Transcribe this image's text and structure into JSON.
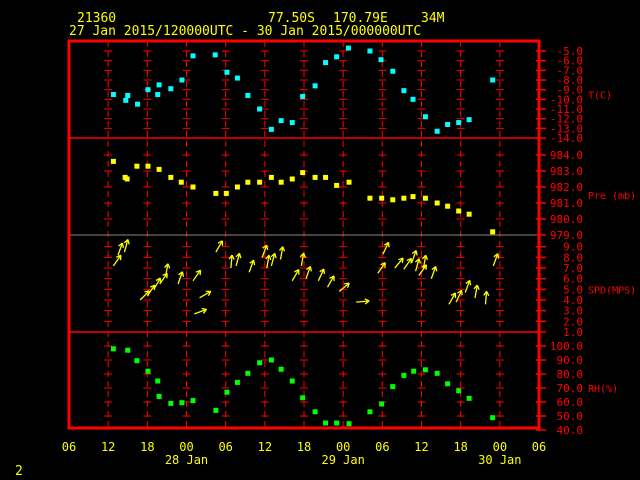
{
  "header": {
    "station": "21360",
    "lat": "77.50S",
    "lon": "170.79E",
    "elev": "34M",
    "time_range": "27 Jan 2015/120000UTC - 30 Jan 2015/000000UTC"
  },
  "footer": {
    "page": "2"
  },
  "chart_data": {
    "type": "scatter",
    "title": "21360 77.50S 170.79E 34M",
    "subtitle": "27 Jan 2015/120000UTC - 30 Jan 2015/000000UTC",
    "x_unit": "hours since 27 Jan 06UTC",
    "xlim": [
      0,
      72
    ],
    "x_ticks": [
      {
        "hour": 0,
        "label": "06"
      },
      {
        "hour": 6,
        "label": "12"
      },
      {
        "hour": 12,
        "label": "18"
      },
      {
        "hour": 18,
        "label": "00"
      },
      {
        "hour": 24,
        "label": "06"
      },
      {
        "hour": 30,
        "label": "12"
      },
      {
        "hour": 36,
        "label": "18"
      },
      {
        "hour": 42,
        "label": "00"
      },
      {
        "hour": 48,
        "label": "06"
      },
      {
        "hour": 54,
        "label": "12"
      },
      {
        "hour": 60,
        "label": "18"
      },
      {
        "hour": 66,
        "label": "00"
      },
      {
        "hour": 72,
        "label": "06"
      }
    ],
    "date_labels": [
      {
        "hour": 18,
        "label": "28 Jan"
      },
      {
        "hour": 42,
        "label": "29 Jan"
      },
      {
        "hour": 66,
        "label": "30 Jan"
      }
    ],
    "panels": [
      {
        "name": "T(C)",
        "color": "#00ffff",
        "ylim": [
          -14,
          -5
        ],
        "ticks": [
          "-5.0",
          "-6.0",
          "-7.0",
          "-8.0",
          "-9.0",
          "-10.0",
          "-11.0",
          "-12.0",
          "-13.0",
          "-14.0"
        ],
        "points": [
          [
            6.8,
            -9.5
          ],
          [
            8.7,
            -10.1
          ],
          [
            9,
            -9.6
          ],
          [
            10.5,
            -10.5
          ],
          [
            12.1,
            -9.0
          ],
          [
            13.8,
            -8.5
          ],
          [
            13.6,
            -9.5
          ],
          [
            15.6,
            -8.9
          ],
          [
            17.3,
            -8.0
          ],
          [
            19,
            -5.5
          ],
          [
            22.4,
            -5.4
          ],
          [
            24.2,
            -7.2
          ],
          [
            25.8,
            -7.8
          ],
          [
            27.4,
            -9.6
          ],
          [
            29.2,
            -11.0
          ],
          [
            31,
            -13.1
          ],
          [
            32.5,
            -12.2
          ],
          [
            34.2,
            -12.4
          ],
          [
            35.8,
            -9.7
          ],
          [
            37.7,
            -8.6
          ],
          [
            39.3,
            -6.2
          ],
          [
            41,
            -5.6
          ],
          [
            42.8,
            -4.7
          ],
          [
            46.1,
            -5.0
          ],
          [
            47.8,
            -5.9
          ],
          [
            49.6,
            -7.1
          ],
          [
            51.3,
            -9.1
          ],
          [
            52.7,
            -10.0
          ],
          [
            54.6,
            -11.8
          ],
          [
            56.4,
            -13.3
          ],
          [
            58,
            -12.6
          ],
          [
            59.7,
            -12.4
          ],
          [
            61.3,
            -12.1
          ],
          [
            64.9,
            -8.0
          ]
        ]
      },
      {
        "name": "Pre (mb)",
        "color": "#ffff00",
        "ylim": [
          979,
          984
        ],
        "ticks": [
          "984.0",
          "983.0",
          "982.0",
          "981.0",
          "980.0",
          "979.0"
        ],
        "points": [
          [
            6.8,
            983.6
          ],
          [
            8.6,
            982.6
          ],
          [
            8.9,
            982.5
          ],
          [
            10.4,
            983.3
          ],
          [
            12.1,
            983.3
          ],
          [
            13.8,
            983.1
          ],
          [
            15.6,
            982.6
          ],
          [
            17.2,
            982.3
          ],
          [
            19,
            982.0
          ],
          [
            22.5,
            981.6
          ],
          [
            24.1,
            981.6
          ],
          [
            25.8,
            982.0
          ],
          [
            27.4,
            982.3
          ],
          [
            29.2,
            982.3
          ],
          [
            31,
            982.6
          ],
          [
            32.5,
            982.3
          ],
          [
            34.2,
            982.5
          ],
          [
            35.8,
            982.9
          ],
          [
            37.7,
            982.6
          ],
          [
            39.3,
            982.6
          ],
          [
            41,
            982.1
          ],
          [
            42.9,
            982.3
          ],
          [
            46.1,
            981.3
          ],
          [
            47.9,
            981.3
          ],
          [
            49.6,
            981.2
          ],
          [
            51.3,
            981.3
          ],
          [
            52.7,
            981.4
          ],
          [
            54.6,
            981.3
          ],
          [
            56.4,
            981.0
          ],
          [
            58,
            980.8
          ],
          [
            59.7,
            980.5
          ],
          [
            61.3,
            980.3
          ],
          [
            64.9,
            979.2
          ]
        ]
      },
      {
        "name": "SPD(MPS)",
        "color": "#ffff00",
        "ylim": [
          1,
          9
        ],
        "marker": "wind-arrow",
        "ticks": [
          "9.0",
          "8.0",
          "7.0",
          "6.0",
          "5.0",
          "4.0",
          "3.0",
          "2.0",
          "1.0"
        ],
        "points": [
          [
            6.8,
            7.2,
            35
          ],
          [
            7.5,
            8.2,
            20
          ],
          [
            8.5,
            8.5,
            15
          ],
          [
            10.9,
            4.0,
            45
          ],
          [
            12,
            4.4,
            35
          ],
          [
            13,
            5.0,
            30
          ],
          [
            13.9,
            5.5,
            35
          ],
          [
            14.8,
            6.2,
            10
          ],
          [
            16.7,
            5.5,
            20
          ],
          [
            19.2,
            2.7,
            70
          ],
          [
            20,
            4.2,
            60
          ],
          [
            19,
            5.8,
            35
          ],
          [
            22.5,
            8.5,
            30
          ],
          [
            24.8,
            7.0,
            5
          ],
          [
            25.6,
            7.2,
            15
          ],
          [
            27.6,
            6.6,
            20
          ],
          [
            29.6,
            8.0,
            20
          ],
          [
            30.3,
            7.0,
            10
          ],
          [
            31,
            7.2,
            15
          ],
          [
            32.4,
            7.8,
            10
          ],
          [
            34.2,
            5.8,
            30
          ],
          [
            35.6,
            7.2,
            10
          ],
          [
            36.3,
            6.0,
            20
          ],
          [
            38.2,
            5.8,
            25
          ],
          [
            39.6,
            5.2,
            30
          ],
          [
            41.4,
            4.8,
            50
          ],
          [
            44,
            3.8,
            85
          ],
          [
            47.3,
            6.5,
            35
          ],
          [
            48.1,
            8.3,
            25
          ],
          [
            49.9,
            7.0,
            40
          ],
          [
            51.3,
            6.9,
            35
          ],
          [
            52.5,
            7.5,
            20
          ],
          [
            53.1,
            6.7,
            15
          ],
          [
            53.6,
            6.3,
            35
          ],
          [
            54.3,
            7.0,
            10
          ],
          [
            55.5,
            6.0,
            20
          ],
          [
            58.2,
            3.6,
            30
          ],
          [
            59.3,
            3.8,
            25
          ],
          [
            60.7,
            4.7,
            20
          ],
          [
            62.2,
            4.2,
            10
          ],
          [
            63.8,
            3.6,
            5
          ],
          [
            65,
            7.2,
            20
          ]
        ]
      },
      {
        "name": "RH(%)",
        "color": "#00ff00",
        "ylim": [
          40,
          100
        ],
        "ticks": [
          "100.0",
          "90.0",
          "80.0",
          "70.0",
          "60.0",
          "50.0",
          "40.0"
        ],
        "points": [
          [
            6.8,
            98
          ],
          [
            9,
            97
          ],
          [
            10.4,
            89.5
          ],
          [
            12.1,
            82
          ],
          [
            13.6,
            75
          ],
          [
            13.8,
            64
          ],
          [
            15.6,
            59
          ],
          [
            17.3,
            59.5
          ],
          [
            19,
            61
          ],
          [
            22.5,
            54
          ],
          [
            24.2,
            67
          ],
          [
            25.8,
            74
          ],
          [
            27.4,
            80.5
          ],
          [
            29.2,
            88
          ],
          [
            31,
            90
          ],
          [
            32.5,
            83.4
          ],
          [
            34.2,
            75
          ],
          [
            35.8,
            63
          ],
          [
            37.7,
            53
          ],
          [
            39.3,
            45
          ],
          [
            41,
            45
          ],
          [
            42.9,
            44.5
          ],
          [
            46.1,
            53
          ],
          [
            47.9,
            58.6
          ],
          [
            49.6,
            71
          ],
          [
            51.3,
            79
          ],
          [
            52.8,
            82
          ],
          [
            54.6,
            83
          ],
          [
            56.4,
            80.5
          ],
          [
            58,
            73
          ],
          [
            59.7,
            68
          ],
          [
            61.3,
            62.6
          ],
          [
            64.9,
            48.8
          ]
        ]
      }
    ]
  }
}
